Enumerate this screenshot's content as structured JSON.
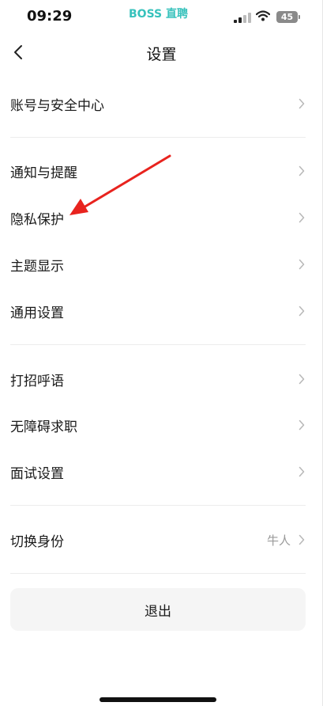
{
  "status_bar": {
    "time": "09:29",
    "app_brand": "BOSS 直聘",
    "battery": "45"
  },
  "nav": {
    "title": "设置"
  },
  "settings": {
    "rows": [
      {
        "label": "账号与安全中心",
        "value": ""
      },
      {
        "label": "通知与提醒",
        "value": ""
      },
      {
        "label": "隐私保护",
        "value": ""
      },
      {
        "label": "主题显示",
        "value": ""
      },
      {
        "label": "通用设置",
        "value": ""
      },
      {
        "label": "打招呼语",
        "value": ""
      },
      {
        "label": "无障碍求职",
        "value": ""
      },
      {
        "label": "面试设置",
        "value": ""
      },
      {
        "label": "切换身份",
        "value": "牛人"
      }
    ]
  },
  "logout_label": "退出",
  "icons": {
    "back": "chevron-left-icon",
    "row_arrow": "chevron-right-icon",
    "signal": "signal-icon",
    "wifi": "wifi-icon",
    "battery": "battery-icon"
  },
  "colors": {
    "brand": "#37c2bc",
    "annotation_arrow": "#e8231e",
    "secondary_text": "#9a9a9a"
  }
}
